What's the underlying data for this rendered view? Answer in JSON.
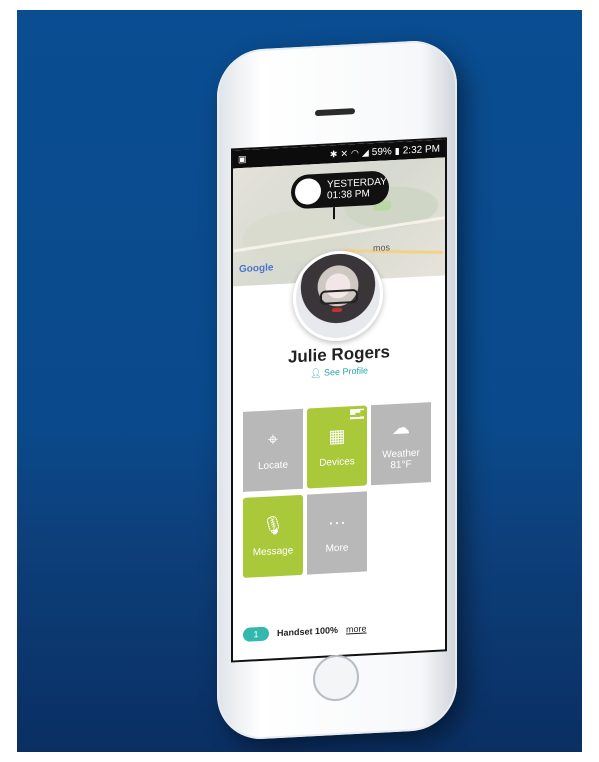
{
  "statusbar": {
    "left_icon": "gallery-icon",
    "icons": [
      "bluetooth-icon",
      "mute-icon",
      "wifi-icon",
      "lte-icon",
      "signal-icon"
    ],
    "battery": "59%",
    "time": "2:32 PM"
  },
  "map": {
    "bubble_line1": "YESTERDAY",
    "bubble_line2": "01:38 PM",
    "google_logo": "Google",
    "place_label": "mos"
  },
  "profile": {
    "name": "Julie Rogers",
    "see_profile": "See Profile"
  },
  "tiles": [
    {
      "label": "Locate",
      "icon": "crosshair-icon",
      "style": "gray"
    },
    {
      "label": "Devices",
      "icon": "devices-icon",
      "style": "green"
    },
    {
      "label": "Weather",
      "sub": "81°F",
      "icon": "cloud-sun-icon",
      "style": "gray"
    },
    {
      "label": "Message",
      "icon": "microphone-icon",
      "style": "green"
    },
    {
      "label": "More",
      "icon": "ellipsis-icon",
      "style": "gray"
    }
  ],
  "footer": {
    "badge": "1",
    "text": "Handset 100%",
    "link": "more"
  },
  "colors": {
    "background_blue": "#0a4d91",
    "tile_gray": "#b8b8b8",
    "tile_green": "#a9c83a",
    "accent_teal": "#33b8ad"
  }
}
